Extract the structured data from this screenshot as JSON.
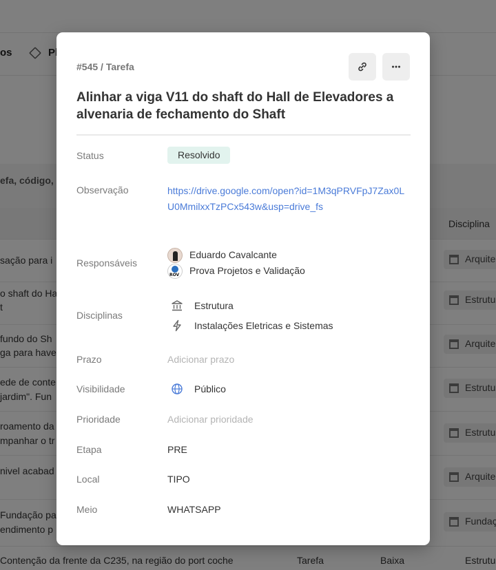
{
  "background": {
    "tab_left_label": "os",
    "tab_right_label": "Pl",
    "search_placeholder": "efa, código, c",
    "column_header": "Disciplina",
    "rows": [
      {
        "text1": "sação para i",
        "text2": "",
        "chip": "Arquite"
      },
      {
        "text1": "o shaft do Ha",
        "text2": "t",
        "chip": "Estrutu"
      },
      {
        "text1": "fundo do Sh",
        "text2": "ga para have",
        "chip": "Arquite"
      },
      {
        "text1": "ede de conte",
        "text2": "jardim\". Fun",
        "chip": "Estrutu"
      },
      {
        "text1": "roamento da",
        "text2": "mpanhar o tr",
        "chip": "Estrutu"
      },
      {
        "text1": "nivel acabad",
        "text2": "",
        "chip": "Arquite"
      },
      {
        "text1": "Fundação pa",
        "text2": "endimento p",
        "chip": "Fundaç"
      }
    ],
    "bottom_row_text": "Contenção da frente da C235, na região do port coche",
    "bottom_type": "Tarefa",
    "bottom_priority": "Baixa",
    "bottom_chip": "Estrutu"
  },
  "modal": {
    "breadcrumb": "#545 / Tarefa",
    "title": "Alinhar a viga V11 do shaft do Hall de Elevadores a alvenaria de fechamento do Shaft",
    "fields": {
      "status_label": "Status",
      "status_value": "Resolvido",
      "observacao_label": "Observação",
      "observacao_value": "https://drive.google.com/open?id=1M3qPRVFpJ7Zax0LU0MmilxxTzPCx543w&usp=drive_fs",
      "responsaveis_label": "Responsáveis",
      "responsaveis": [
        "Eduardo Cavalcante",
        "Prova Projetos e Validação"
      ],
      "disciplinas_label": "Disciplinas",
      "disciplinas": [
        "Estrutura",
        "Instalações Eletricas e Sistemas"
      ],
      "prazo_label": "Prazo",
      "prazo_placeholder": "Adicionar prazo",
      "visibilidade_label": "Visibilidade",
      "visibilidade_value": "Público",
      "prioridade_label": "Prioridade",
      "prioridade_placeholder": "Adicionar prioridade",
      "etapa_label": "Etapa",
      "etapa_value": "PRE",
      "local_label": "Local",
      "local_value": "TIPO",
      "meio_label": "Meio",
      "meio_value": "WHATSAPP"
    }
  },
  "colors": {
    "link": "#4a7bd8",
    "status_badge_bg": "#e2f3ee",
    "overlay": "rgba(0,0,0,0.5)"
  }
}
